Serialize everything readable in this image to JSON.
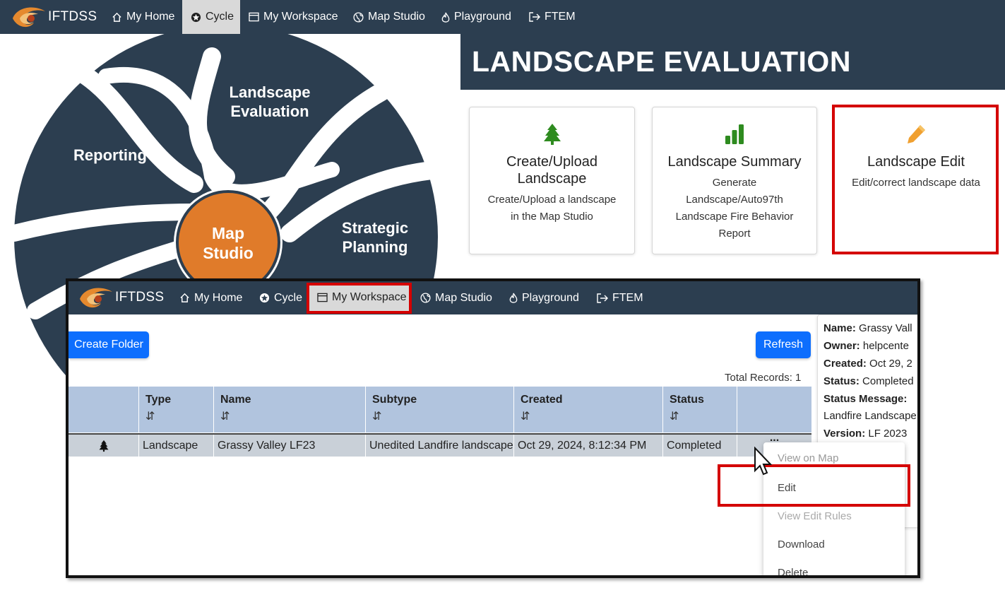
{
  "app_name": "IFTDSS",
  "nav": {
    "items": [
      {
        "label": "My Home",
        "icon": "home-icon"
      },
      {
        "label": "Cycle",
        "icon": "cycle-icon"
      },
      {
        "label": "My Workspace",
        "icon": "window-icon"
      },
      {
        "label": "Map Studio",
        "icon": "globe-icon"
      },
      {
        "label": "Playground",
        "icon": "fire-icon"
      },
      {
        "label": "FTEM",
        "icon": "export-icon"
      }
    ],
    "active_top": "Cycle",
    "active_workspace": "My Workspace"
  },
  "cycle": {
    "segments": [
      "Landscape Evaluation",
      "Reporting",
      "Strategic Planning"
    ],
    "center_line1": "Map",
    "center_line2": "Studio",
    "colors": {
      "segment": "#2c3e50",
      "center": "#e07b2a"
    }
  },
  "landscape_evaluation": {
    "title": "LANDSCAPE EVALUATION",
    "cards": [
      {
        "icon": "tree-icon",
        "title_line1": "Create/Upload",
        "title_line2": "Landscape",
        "desc_line1": "Create/Upload a landscape",
        "desc_line2": "in the Map Studio"
      },
      {
        "icon": "bar-chart-icon",
        "title": "Landscape Summary",
        "desc_line1": "Generate",
        "desc_line2": "Landscape/Auto97th",
        "desc_line3": "Landscape Fire Behavior",
        "desc_line4": "Report"
      },
      {
        "icon": "pencil-icon",
        "title": "Landscape Edit",
        "desc": "Edit/correct landscape data"
      }
    ]
  },
  "workspace": {
    "create_folder": "Create Folder",
    "refresh": "Refresh",
    "total_records": "Total Records: 1",
    "columns": [
      "Type",
      "Name",
      "Subtype",
      "Created",
      "Status"
    ],
    "sort_glyph": "⇵",
    "row": {
      "icon": "tree-icon",
      "type": "Landscape",
      "name": "Grassy Valley LF23",
      "subtype": "Unedited Landfire landscape",
      "created": "Oct 29, 2024, 8:12:34 PM",
      "status": "Completed",
      "actions": "..."
    },
    "details": {
      "name_label": "Name:",
      "name_value": "Grassy Vall",
      "owner_label": "Owner:",
      "owner_value": "helpcente",
      "created_label": "Created:",
      "created_value": "Oct 29, 2",
      "status_label": "Status:",
      "status_value": "Completed",
      "status_message_label": "Status Message:",
      "status_message_value": "Landfire Landscape",
      "version_label": "Version:",
      "version_value": "LF 2023"
    },
    "menu": [
      "View on Map",
      "Edit",
      "View Edit Rules",
      "Download",
      "Delete"
    ]
  },
  "colors": {
    "nav": "#2c3e50",
    "primary": "#0d6efd",
    "highlight": "#d40000",
    "accent_green": "#2e8b1f",
    "accent_orange": "#f0a030"
  }
}
